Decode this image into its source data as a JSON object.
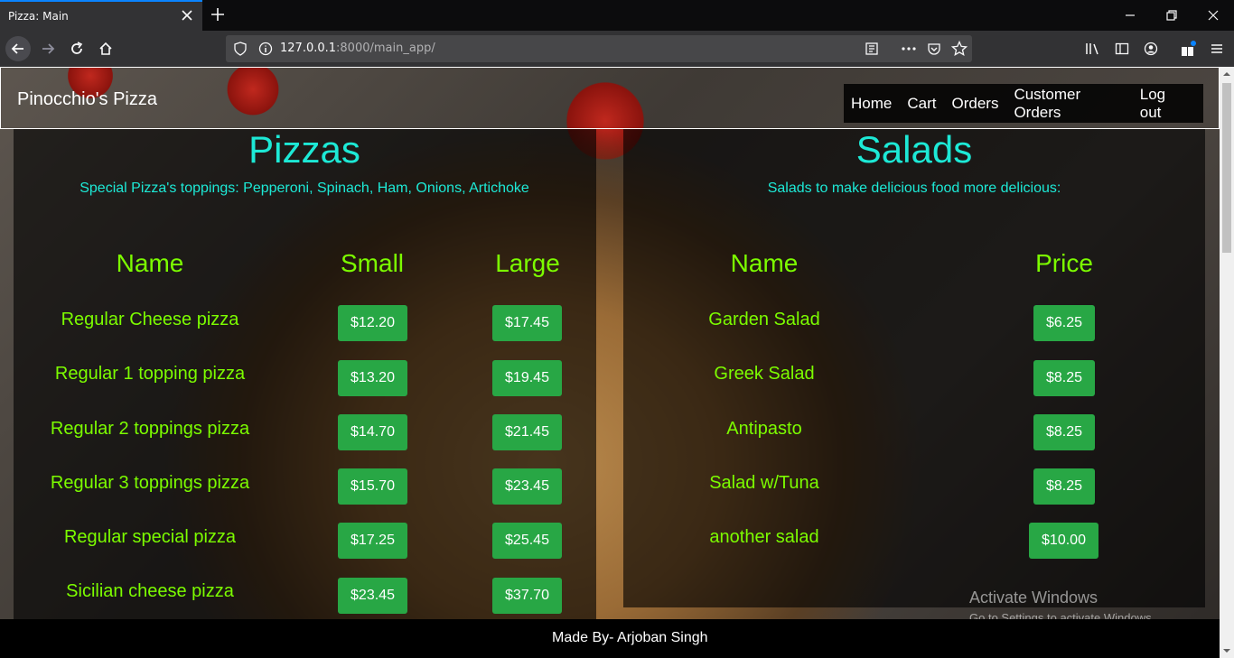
{
  "browser": {
    "tab_title": "Pizza: Main",
    "url_host": "127.0.0.1",
    "url_rest": ":8000/main_app/"
  },
  "header": {
    "brand": "Pinocchio's Pizza",
    "menu": [
      "Home",
      "Cart",
      "Orders",
      "Customer Orders",
      "Log out"
    ]
  },
  "pizzas": {
    "title": "Pizzas",
    "subtitle": "Special Pizza's toppings: Pepperoni, Spinach, Ham, Onions, Artichoke",
    "headers": [
      "Name",
      "Small",
      "Large"
    ],
    "rows": [
      {
        "name": "Regular Cheese pizza",
        "small": "$12.20",
        "large": "$17.45"
      },
      {
        "name": "Regular 1 topping pizza",
        "small": "$13.20",
        "large": "$19.45"
      },
      {
        "name": "Regular 2 toppings pizza",
        "small": "$14.70",
        "large": "$21.45"
      },
      {
        "name": "Regular 3 toppings pizza",
        "small": "$15.70",
        "large": "$23.45"
      },
      {
        "name": "Regular special pizza",
        "small": "$17.25",
        "large": "$25.45"
      },
      {
        "name": "Sicilian cheese pizza",
        "small": "$23.45",
        "large": "$37.70"
      }
    ]
  },
  "salads": {
    "title": "Salads",
    "subtitle": "Salads to make delicious food more delicious:",
    "headers": [
      "Name",
      "Price"
    ],
    "rows": [
      {
        "name": "Garden Salad",
        "price": "$6.25"
      },
      {
        "name": "Greek Salad",
        "price": "$8.25"
      },
      {
        "name": "Antipasto",
        "price": "$8.25"
      },
      {
        "name": "Salad w/Tuna",
        "price": "$8.25"
      },
      {
        "name": "another salad",
        "price": "$10.00"
      }
    ]
  },
  "watermark": {
    "line1": "Activate Windows",
    "line2": "Go to Settings to activate Windows."
  },
  "footer": {
    "text": "Made By- Arjoban Singh"
  },
  "colors": {
    "accent_title": "#1de9d6",
    "accent_text": "#7cfc00",
    "button": "#28a745"
  }
}
